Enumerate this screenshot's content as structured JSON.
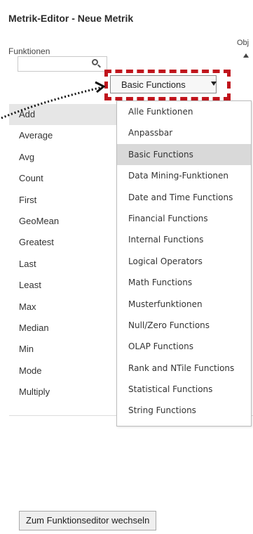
{
  "header": {
    "title": "Metrik-Editor - Neue Metrik",
    "functions_label": "Funktionen",
    "objects_label": "Obj"
  },
  "search": {
    "value": "",
    "placeholder": ""
  },
  "category_select": {
    "selected": "Basic Functions"
  },
  "function_list": [
    {
      "label": "Add"
    },
    {
      "label": "Average"
    },
    {
      "label": "Avg"
    },
    {
      "label": "Count"
    },
    {
      "label": "First"
    },
    {
      "label": "GeoMean"
    },
    {
      "label": "Greatest"
    },
    {
      "label": "Last"
    },
    {
      "label": "Least"
    },
    {
      "label": "Max"
    },
    {
      "label": "Median"
    },
    {
      "label": "Min"
    },
    {
      "label": "Mode"
    },
    {
      "label": "Multiply"
    }
  ],
  "category_options": [
    {
      "label": "Alle Funktionen"
    },
    {
      "label": "Anpassbar"
    },
    {
      "label": "Basic Functions"
    },
    {
      "label": "Data Mining-Funktionen"
    },
    {
      "label": "Date and Time Functions"
    },
    {
      "label": "Financial Functions"
    },
    {
      "label": "Internal Functions"
    },
    {
      "label": "Logical Operators"
    },
    {
      "label": "Math Functions"
    },
    {
      "label": "Musterfunktionen"
    },
    {
      "label": "Null/Zero Functions"
    },
    {
      "label": "OLAP Functions"
    },
    {
      "label": "Rank and NTile Functions"
    },
    {
      "label": "Statistical Functions"
    },
    {
      "label": "String Functions"
    }
  ],
  "footer": {
    "switch_button_label": "Zum Funktionseditor wechseln"
  },
  "colors": {
    "highlight": "#c0141c",
    "selected_bg": "#d9d9d9",
    "first_row_bg": "#e6e6e6"
  }
}
